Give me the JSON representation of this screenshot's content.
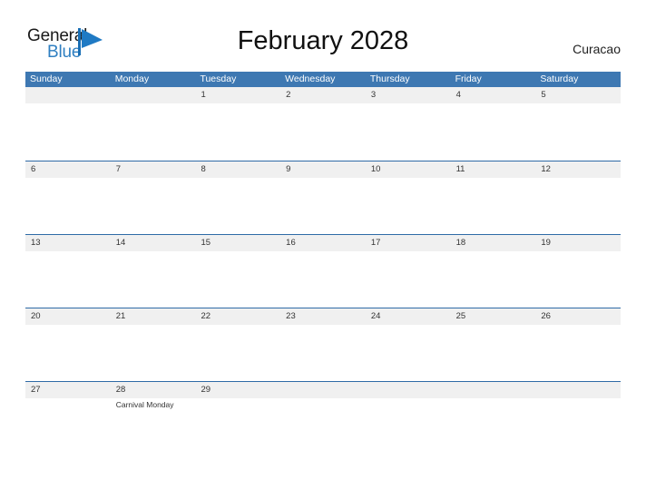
{
  "brand": {
    "name_part1": "General",
    "name_part2": "Blue",
    "flag_icon": "blue-flag-icon",
    "color_primary": "#2f7fc1",
    "color_text": "#1a1a1a"
  },
  "header": {
    "title": "February 2028",
    "location": "Curacao"
  },
  "theme": {
    "header_bar_color": "#3e78b2",
    "row_line_color": "#2f6ba6",
    "date_band_color": "#f0f0f0",
    "page_background": "#ffffff",
    "text_color": "#333333"
  },
  "calendar": {
    "month": "February",
    "year": "2028",
    "weekdays": [
      "Sunday",
      "Monday",
      "Tuesday",
      "Wednesday",
      "Thursday",
      "Friday",
      "Saturday"
    ],
    "weeks": [
      {
        "days": [
          {
            "number": "",
            "event": ""
          },
          {
            "number": "",
            "event": ""
          },
          {
            "number": "1",
            "event": ""
          },
          {
            "number": "2",
            "event": ""
          },
          {
            "number": "3",
            "event": ""
          },
          {
            "number": "4",
            "event": ""
          },
          {
            "number": "5",
            "event": ""
          }
        ]
      },
      {
        "days": [
          {
            "number": "6",
            "event": ""
          },
          {
            "number": "7",
            "event": ""
          },
          {
            "number": "8",
            "event": ""
          },
          {
            "number": "9",
            "event": ""
          },
          {
            "number": "10",
            "event": ""
          },
          {
            "number": "11",
            "event": ""
          },
          {
            "number": "12",
            "event": ""
          }
        ]
      },
      {
        "days": [
          {
            "number": "13",
            "event": ""
          },
          {
            "number": "14",
            "event": ""
          },
          {
            "number": "15",
            "event": ""
          },
          {
            "number": "16",
            "event": ""
          },
          {
            "number": "17",
            "event": ""
          },
          {
            "number": "18",
            "event": ""
          },
          {
            "number": "19",
            "event": ""
          }
        ]
      },
      {
        "days": [
          {
            "number": "20",
            "event": ""
          },
          {
            "number": "21",
            "event": ""
          },
          {
            "number": "22",
            "event": ""
          },
          {
            "number": "23",
            "event": ""
          },
          {
            "number": "24",
            "event": ""
          },
          {
            "number": "25",
            "event": ""
          },
          {
            "number": "26",
            "event": ""
          }
        ]
      },
      {
        "days": [
          {
            "number": "27",
            "event": ""
          },
          {
            "number": "28",
            "event": "Carnival Monday"
          },
          {
            "number": "29",
            "event": ""
          },
          {
            "number": "",
            "event": ""
          },
          {
            "number": "",
            "event": ""
          },
          {
            "number": "",
            "event": ""
          },
          {
            "number": "",
            "event": ""
          }
        ]
      }
    ]
  }
}
